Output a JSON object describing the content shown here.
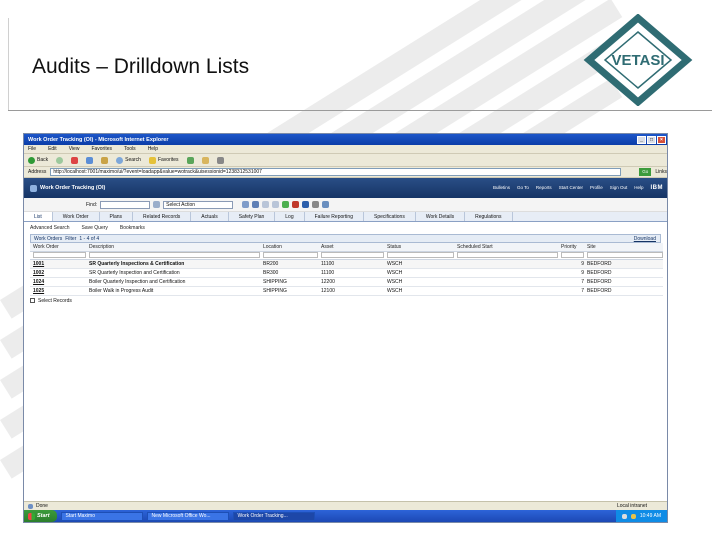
{
  "slide": {
    "title": "Audits – Drilldown Lists",
    "logo_text": "VETASI"
  },
  "window": {
    "title": "Work Order Tracking (OI) - Microsoft Internet Explorer",
    "menu": [
      "File",
      "Edit",
      "View",
      "Favorites",
      "Tools",
      "Help"
    ],
    "toolbar": {
      "back": "Back",
      "search": "Search",
      "favorites": "Favorites"
    },
    "address_label": "Address",
    "address": "http://localhost:7001/maximo/ui/?event=loadapp&value=wotrack&uisessionid=1238312531007",
    "go": "Go",
    "links": "Links"
  },
  "app": {
    "name": "Work Order Tracking (OI)",
    "nav": [
      "Bulletins",
      "Go To",
      "Reports",
      "Start Center",
      "Profile",
      "Sign Out",
      "Help"
    ],
    "brand": "IBM",
    "find_label": "Find:",
    "select_action": "Select Action",
    "tabs": [
      "List",
      "Work Order",
      "Plans",
      "Related Records",
      "Actuals",
      "Safety Plan",
      "Log",
      "Failure Reporting",
      "Specifications",
      "Work Details",
      "Regulations"
    ],
    "active_tab": "List",
    "actions": [
      "Advanced Search",
      "Save Query",
      "Bookmarks"
    ],
    "list": {
      "title": "Work Orders",
      "filter": "Filter",
      "paging": "1 - 4 of 4",
      "download": "Download",
      "columns": [
        "Work Order",
        "Description",
        "Location",
        "Asset",
        "Status",
        "Scheduled Start",
        "Priority",
        "Site"
      ],
      "rows": [
        [
          "1001",
          "SR Quarterly Inspections & Certification",
          "BR200",
          "11100",
          "WSCH",
          "",
          "9",
          "BEDFORD"
        ],
        [
          "1002",
          "SR Quarterly Inspection and Certification",
          "BR300",
          "11100",
          "WSCH",
          "",
          "9",
          "BEDFORD"
        ],
        [
          "1024",
          "Boiler Quarterly Inspection and Certification",
          "SHIPPING",
          "12200",
          "WSCH",
          "",
          "7",
          "BEDFORD"
        ],
        [
          "1025",
          "Boiler Walk in Progress Audit",
          "SHIPPING",
          "12100",
          "WSCH",
          "",
          "7",
          "BEDFORD"
        ]
      ],
      "select_records": "Select Records"
    }
  },
  "statusbar": {
    "text": "Done",
    "zone": "Local intranet"
  },
  "taskbar": {
    "start": "Start",
    "tasks": [
      "Start Maximo",
      "New Microsoft Office Wo...",
      "Work Order Tracking..."
    ],
    "clock": "10:49 AM"
  }
}
